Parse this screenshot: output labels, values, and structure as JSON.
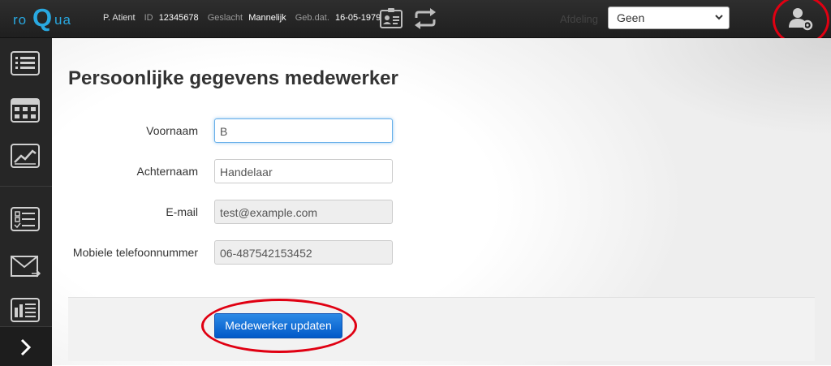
{
  "header": {
    "logo_left": "ro",
    "logo_q": "Q",
    "logo_right": "ua",
    "patient_name": "P. Atient",
    "id_label": "ID",
    "id_value": "12345678",
    "gender_label": "Geslacht",
    "gender_value": "Mannelijk",
    "dob_label": "Geb.dat.",
    "dob_value": "16-05-1979",
    "department_label": "Afdeling",
    "department_selected": "Geen",
    "icons": [
      "patient-card-icon",
      "switch-patient-icon",
      "user-settings-icon"
    ]
  },
  "sidebar": {
    "items": [
      "dashboard-list-icon",
      "calendar-icon",
      "chart-icon",
      "checklist-icon",
      "mail-icon",
      "report-icon"
    ],
    "expand_icon": "chevron-right-icon"
  },
  "page": {
    "title": "Persoonlijke gegevens medewerker"
  },
  "form": {
    "first_name_label": "Voornaam",
    "first_name_value": "B",
    "last_name_label": "Achternaam",
    "last_name_value": "Handelaar",
    "email_label": "E-mail",
    "email_value": "test@example.com",
    "mobile_label": "Mobiele telefoonnummer",
    "mobile_value": "06-487542153452",
    "submit_label": "Medewerker updaten"
  },
  "colors": {
    "brand": "#29a8e0",
    "topbar": "#262626",
    "button": "#0f6ad8",
    "highlight_circle": "#e00012"
  }
}
